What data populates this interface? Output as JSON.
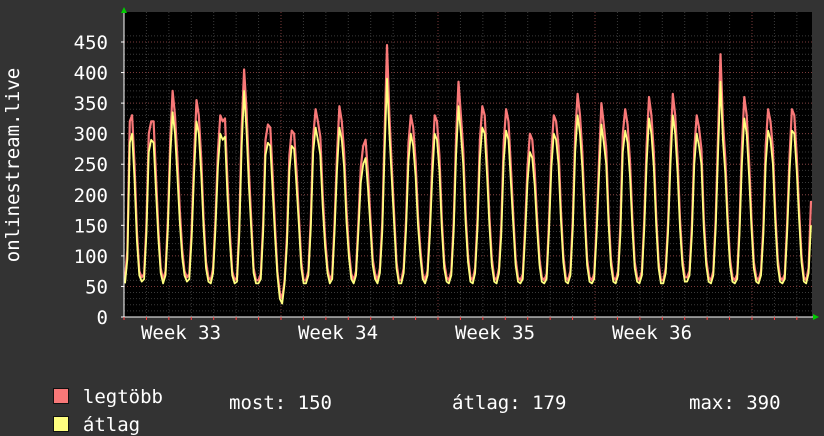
{
  "chart_data": {
    "type": "line",
    "ylabel": "onlinestream.live",
    "ylim": [
      0,
      460
    ],
    "yticks": [
      0,
      50,
      100,
      150,
      200,
      250,
      300,
      350,
      400,
      450
    ],
    "xticks": [
      "Week 33",
      "Week 34",
      "Week 35",
      "Week 36"
    ],
    "grid": true,
    "series": [
      {
        "name": "legtöbb",
        "color": "#f87878",
        "values": [
          60,
          110,
          320,
          330,
          250,
          140,
          75,
          65,
          70,
          150,
          300,
          320,
          320,
          230,
          145,
          80,
          60,
          75,
          160,
          290,
          370,
          330,
          260,
          175,
          110,
          75,
          65,
          70,
          145,
          260,
          355,
          330,
          260,
          160,
          90,
          65,
          60,
          80,
          160,
          270,
          330,
          320,
          325,
          225,
          140,
          75,
          60,
          65,
          150,
          310,
          405,
          340,
          240,
          160,
          80,
          60,
          60,
          70,
          155,
          290,
          315,
          310,
          230,
          145,
          75,
          40,
          30,
          60,
          135,
          265,
          305,
          300,
          240,
          165,
          90,
          60,
          60,
          75,
          160,
          295,
          340,
          320,
          295,
          200,
          130,
          80,
          60,
          70,
          155,
          265,
          345,
          320,
          270,
          175,
          110,
          70,
          60,
          75,
          155,
          245,
          280,
          290,
          235,
          165,
          95,
          70,
          60,
          80,
          155,
          300,
          445,
          330,
          245,
          165,
          90,
          60,
          60,
          80,
          160,
          285,
          330,
          310,
          255,
          165,
          110,
          70,
          60,
          75,
          150,
          255,
          330,
          320,
          265,
          160,
          90,
          65,
          60,
          75,
          155,
          295,
          385,
          330,
          275,
          170,
          100,
          65,
          60,
          80,
          160,
          290,
          345,
          330,
          255,
          165,
          95,
          65,
          60,
          80,
          150,
          285,
          340,
          320,
          245,
          165,
          95,
          65,
          60,
          70,
          150,
          245,
          300,
          290,
          240,
          160,
          95,
          65,
          60,
          70,
          155,
          270,
          330,
          320,
          280,
          175,
          100,
          65,
          60,
          75,
          160,
          300,
          365,
          330,
          270,
          175,
          95,
          65,
          60,
          70,
          150,
          255,
          350,
          315,
          275,
          170,
          95,
          65,
          60,
          75,
          150,
          300,
          340,
          315,
          255,
          160,
          90,
          65,
          60,
          75,
          160,
          280,
          360,
          330,
          270,
          165,
          90,
          60,
          60,
          80,
          155,
          275,
          365,
          330,
          260,
          160,
          95,
          65,
          65,
          75,
          150,
          275,
          330,
          310,
          275,
          160,
          95,
          65,
          60,
          75,
          160,
          300,
          430,
          320,
          260,
          165,
          95,
          65,
          60,
          70,
          150,
          280,
          360,
          330,
          255,
          160,
          90,
          65,
          60,
          75,
          150,
          280,
          340,
          320,
          275,
          170,
          95,
          65,
          60,
          70,
          155,
          265,
          340,
          330,
          265,
          175,
          100,
          65,
          60,
          80,
          190
        ]
      },
      {
        "name": "átlag",
        "color": "#ffff80",
        "values": [
          55,
          95,
          285,
          300,
          225,
          125,
          68,
          58,
          62,
          135,
          270,
          290,
          285,
          205,
          130,
          72,
          55,
          68,
          145,
          265,
          335,
          300,
          230,
          155,
          98,
          68,
          58,
          62,
          130,
          235,
          320,
          300,
          235,
          145,
          80,
          58,
          55,
          72,
          145,
          245,
          300,
          290,
          295,
          200,
          125,
          68,
          55,
          58,
          135,
          280,
          370,
          305,
          215,
          145,
          72,
          55,
          55,
          62,
          140,
          265,
          285,
          280,
          205,
          130,
          68,
          30,
          22,
          55,
          120,
          240,
          280,
          275,
          215,
          150,
          80,
          55,
          55,
          68,
          145,
          270,
          310,
          290,
          265,
          180,
          115,
          72,
          55,
          62,
          140,
          240,
          310,
          290,
          245,
          155,
          98,
          62,
          55,
          68,
          140,
          220,
          250,
          260,
          210,
          150,
          85,
          62,
          55,
          72,
          140,
          270,
          390,
          300,
          225,
          150,
          80,
          55,
          55,
          72,
          145,
          255,
          300,
          280,
          230,
          150,
          98,
          62,
          55,
          68,
          135,
          230,
          300,
          290,
          240,
          145,
          80,
          58,
          55,
          68,
          140,
          265,
          345,
          300,
          250,
          155,
          90,
          58,
          55,
          72,
          145,
          260,
          310,
          300,
          230,
          150,
          85,
          58,
          55,
          72,
          135,
          255,
          305,
          290,
          220,
          150,
          85,
          58,
          55,
          62,
          135,
          220,
          270,
          260,
          215,
          145,
          85,
          58,
          55,
          62,
          140,
          245,
          300,
          290,
          250,
          160,
          90,
          58,
          55,
          68,
          145,
          270,
          330,
          300,
          245,
          160,
          85,
          58,
          55,
          62,
          135,
          230,
          315,
          285,
          250,
          155,
          85,
          58,
          55,
          68,
          135,
          270,
          305,
          285,
          230,
          145,
          80,
          58,
          55,
          68,
          145,
          250,
          325,
          300,
          245,
          150,
          80,
          55,
          55,
          72,
          140,
          250,
          330,
          300,
          235,
          145,
          85,
          58,
          58,
          68,
          135,
          250,
          300,
          280,
          250,
          145,
          85,
          58,
          55,
          68,
          145,
          270,
          385,
          290,
          235,
          150,
          85,
          58,
          55,
          62,
          135,
          250,
          325,
          300,
          230,
          145,
          80,
          58,
          55,
          68,
          135,
          250,
          305,
          290,
          250,
          155,
          85,
          58,
          55,
          62,
          140,
          240,
          305,
          300,
          240,
          160,
          90,
          58,
          55,
          72,
          150
        ]
      }
    ]
  },
  "legend": {
    "max_label": "legtöbb",
    "avg_label": "átlag",
    "max_color": "#f87878",
    "avg_color": "#ffff80"
  },
  "stats": {
    "now": "most: 150",
    "avg": "átlag: 179",
    "max": "max: 390"
  }
}
